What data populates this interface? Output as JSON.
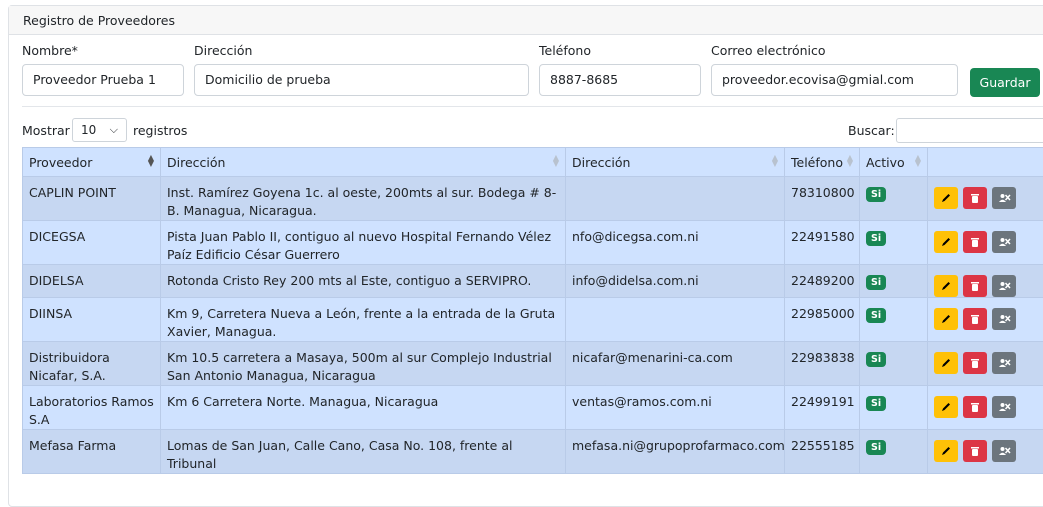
{
  "header": {
    "title": "Registro de Proveedores"
  },
  "form": {
    "nombre_label": "Nombre*",
    "nombre_value": "Proveedor Prueba 1",
    "direccion_label": "Dirección",
    "direccion_value": "Domicilio de prueba",
    "telefono_label": "Teléfono",
    "telefono_value": "8887-8685",
    "correo_label": "Correo electrónico",
    "correo_value": "proveedor.ecovisa@gmial.com",
    "save_label": "Guardar"
  },
  "table_controls": {
    "show_label": "Mostrar",
    "page_length": "10",
    "records_label": "registros",
    "search_label": "Buscar:"
  },
  "table": {
    "columns": [
      "Proveedor",
      "Dirección",
      "Dirección",
      "Teléfono",
      "Activo",
      ""
    ],
    "rows": [
      {
        "name": "CAPLIN POINT",
        "address": "Inst. Ramírez Goyena 1c. al oeste, 200mts al sur. Bodega # 8-B. Managua, Nicaragua.",
        "email": "",
        "phone": "78310800",
        "active": "Si"
      },
      {
        "name": "DICEGSA",
        "address": "Pista Juan Pablo II, contiguo al nuevo Hospital Fernando Vélez Paíz Edificio César Guerrero",
        "email": "nfo@dicegsa.com.ni",
        "phone": "22491580",
        "active": "Si"
      },
      {
        "name": "DIDELSA",
        "address": "Rotonda Cristo Rey 200 mts al Este, contiguo a SERVIPRO.",
        "email": "info@didelsa.com.ni",
        "phone": "22489200",
        "active": "Si"
      },
      {
        "name": "DIINSA",
        "address": "Km 9, Carretera Nueva a León, frente a la entrada de la Gruta Xavier, Managua.",
        "email": "",
        "phone": "22985000",
        "active": "Si"
      },
      {
        "name": "Distribuidora Nicafar, S.A.",
        "address": "Km 10.5 carretera a Masaya, 500m al sur Complejo Industrial San Antonio Managua, Nicaragua",
        "email": "nicafar@menarini-ca.com",
        "phone": "22983838",
        "active": "Si"
      },
      {
        "name": "Laboratorios Ramos S.A",
        "address": "Km 6 Carretera Norte. Managua, Nicaragua",
        "email": "ventas@ramos.com.ni",
        "phone": "22499191",
        "active": "Si"
      },
      {
        "name": "Mefasa Farma",
        "address": "Lomas de San Juan, Calle Cano, Casa No. 108, frente al Tribunal",
        "email": "mefasa.ni@grupoprofarmaco.com",
        "phone": "22555185",
        "active": "Si"
      }
    ]
  },
  "colors": {
    "header_blue": "#cfe2ff",
    "success": "#198754",
    "warning": "#ffc107",
    "danger": "#dc3545",
    "secondary": "#6c757d"
  },
  "icons": [
    "pencil-icon",
    "trash-icon",
    "deactivate-icon",
    "sort-icon",
    "chevron-down-icon"
  ]
}
